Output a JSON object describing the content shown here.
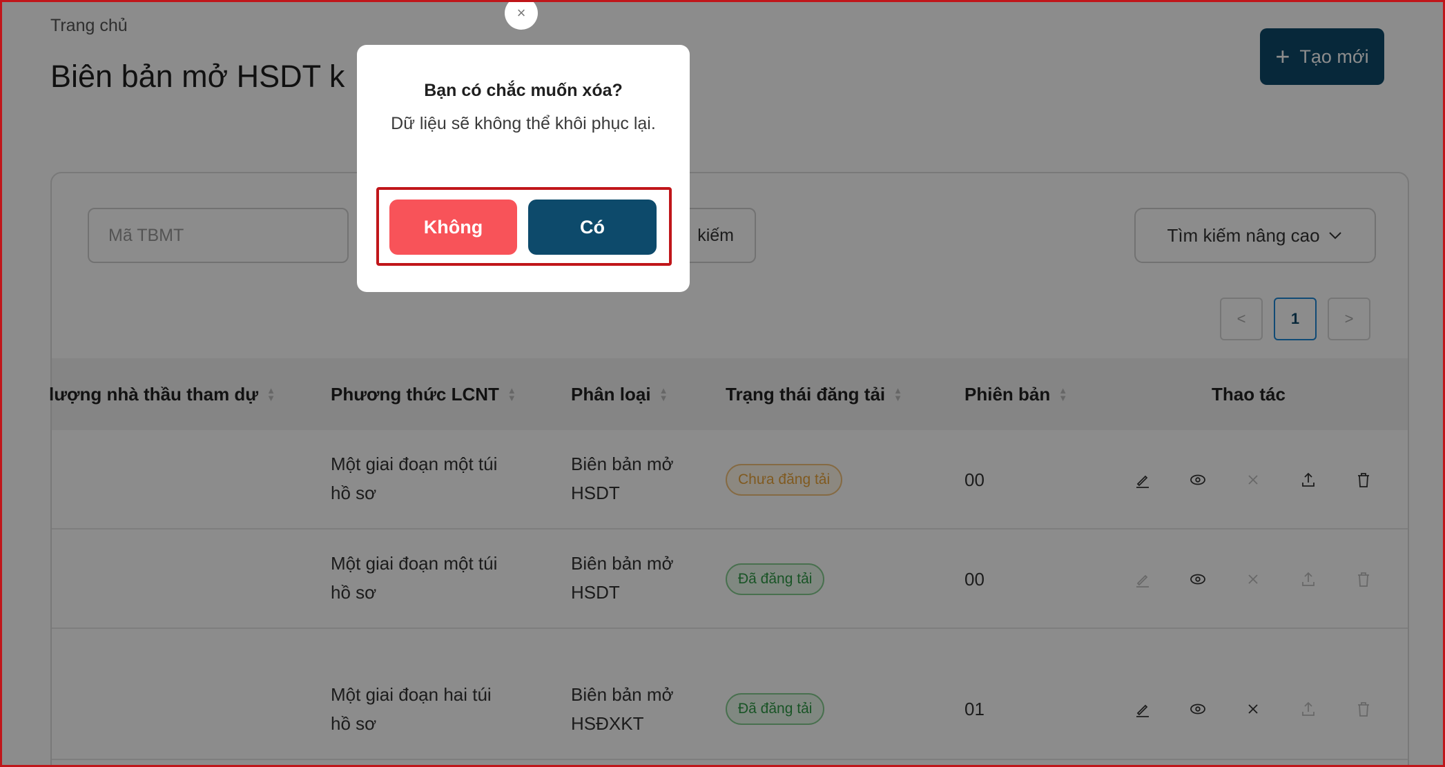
{
  "breadcrumb": "Trang chủ",
  "page_title": "Biên bản mở HSDT k",
  "create_button": {
    "icon": "plus-icon",
    "label": "Tạo mới"
  },
  "filters": {
    "tbmt_placeholder": "Mã TBMT",
    "search_label": "kiếm",
    "advanced_search_label": "Tìm kiếm nâng cao"
  },
  "pagination": {
    "prev": "<",
    "current": "1",
    "next": ">"
  },
  "table": {
    "headers": {
      "bidders": "lượng nhà thầu tham dự",
      "method": "Phương thức LCNT",
      "category": "Phân loại",
      "status": "Trạng thái đăng tải",
      "version": "Phiên bản",
      "actions": "Thao tác"
    },
    "rows": [
      {
        "method": [
          "Một giai đoạn một túi",
          "hồ sơ"
        ],
        "category": [
          "Biên bản mở",
          "HSDT"
        ],
        "status": "Chưa đăng tải",
        "version": "00"
      },
      {
        "method": [
          "Một giai đoạn một túi",
          "hồ sơ"
        ],
        "category": [
          "Biên bản mở",
          "HSDT"
        ],
        "status": "Đã đăng tải",
        "version": "00"
      },
      {
        "method": [
          "Một giai đoạn hai túi",
          "hồ sơ"
        ],
        "category": [
          "Biên bản mở",
          "HSĐXKT"
        ],
        "status": "Đã đăng tải",
        "version": "01"
      }
    ]
  },
  "modal": {
    "close": "×",
    "title": "Bạn có chắc muốn xóa?",
    "message": "Dữ liệu sẽ không thể khôi phục lại.",
    "no_label": "Không",
    "yes_label": "Có"
  },
  "colors": {
    "primary": "#0d4a6b",
    "danger": "#f85359",
    "highlight": "#c0161a",
    "pending": "#e9a43b",
    "posted": "#2e9a45"
  }
}
